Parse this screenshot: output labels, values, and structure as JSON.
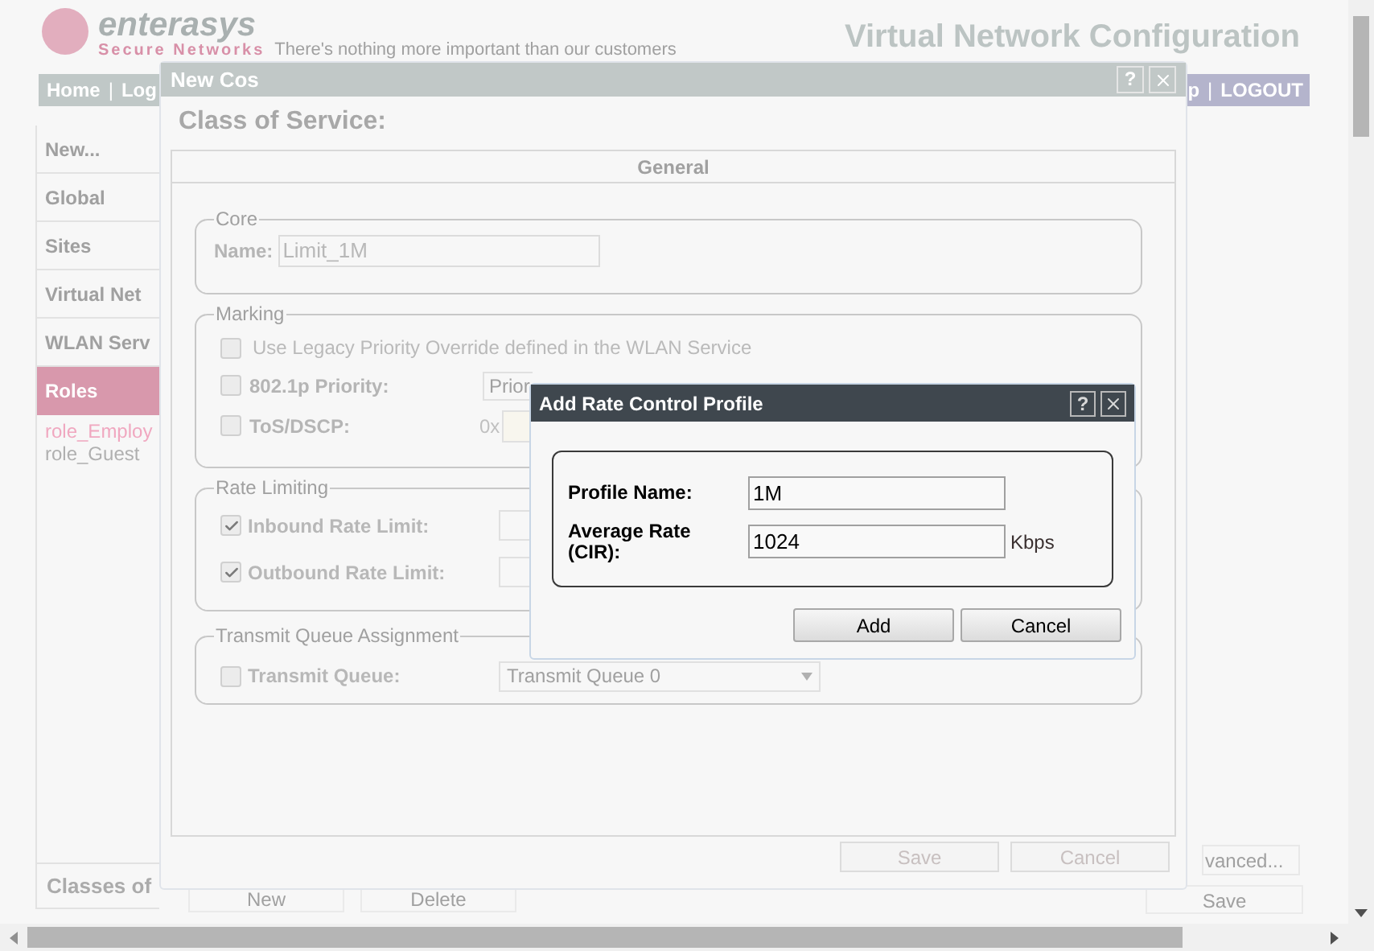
{
  "header": {
    "logo": "enterasys",
    "logo_subtitle": "Secure Networks",
    "tagline": "There's nothing more important than our customers",
    "title": "Virtual Network Configuration"
  },
  "nav": {
    "left": [
      {
        "kind": "link",
        "label": "Home"
      },
      {
        "kind": "separator",
        "label": "|"
      },
      {
        "kind": "link",
        "label": "Log"
      }
    ],
    "right": [
      {
        "kind": "link",
        "label": "p"
      },
      {
        "kind": "separator",
        "label": "|"
      },
      {
        "kind": "link",
        "label": "LOGOUT"
      }
    ]
  },
  "sidebar": {
    "items": [
      {
        "label": "New...",
        "selected": false
      },
      {
        "label": "Global",
        "selected": false
      },
      {
        "label": "Sites",
        "selected": false
      },
      {
        "label": "Virtual Net",
        "selected": false
      },
      {
        "label": "WLAN Serv",
        "selected": false
      },
      {
        "label": "Roles",
        "selected": true,
        "children": [
          {
            "label": "role_Employ",
            "selected": true
          },
          {
            "label": "role_Guest",
            "selected": false
          }
        ]
      }
    ],
    "footer": "Classes of"
  },
  "background_buttons": {
    "list": [
      "New",
      "Delete"
    ],
    "advanced": "vanced...",
    "save": "Save"
  },
  "cos_dialog": {
    "title": "New Cos",
    "help": "?",
    "heading": "Class of Service:",
    "tab": "General",
    "core": {
      "legend": "Core",
      "name_label": "Name:",
      "name_value": "Limit_1M"
    },
    "marking": {
      "legend": "Marking",
      "legacy": {
        "label": "Use Legacy Priority Override defined in the WLAN Service",
        "checked": false
      },
      "priority": {
        "label": "802.1p Priority:",
        "checked": false,
        "value": "Prior"
      },
      "tos": {
        "label": "ToS/DSCP:",
        "checked": false,
        "prefix": "0x"
      }
    },
    "rate_limiting": {
      "legend": "Rate Limiting",
      "inbound": {
        "label": "Inbound Rate Limit:",
        "checked": true
      },
      "outbound": {
        "label": "Outbound Rate Limit:",
        "checked": true
      }
    },
    "transmit_queue": {
      "legend": "Transmit Queue Assignment",
      "label": "Transmit Queue:",
      "checked": false,
      "value": "Transmit Queue 0"
    },
    "buttons": [
      "Save",
      "Cancel"
    ]
  },
  "rate_dialog": {
    "title": "Add Rate Control Profile",
    "help": "?",
    "fields": [
      {
        "label": "Profile Name:",
        "value": "1M"
      },
      {
        "label": "Average Rate (CIR):",
        "value": "1024",
        "unit": "Kbps"
      }
    ],
    "buttons": [
      "Add",
      "Cancel"
    ]
  }
}
